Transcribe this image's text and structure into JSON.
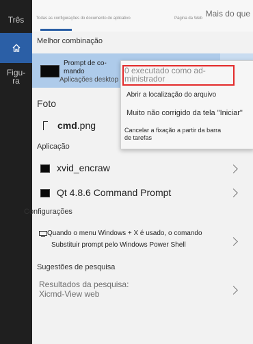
{
  "rail": {
    "top_label": "Três",
    "bottom_label": "Figu-\nra"
  },
  "tabs": {
    "all_settings": "Todas as configurações do documento do aplicativo",
    "web_page": "Página da Web",
    "more": "Mais do que"
  },
  "best_match": {
    "header": "Melhor combinação",
    "title_line1": "Prompt de co-",
    "title_line2": "mando",
    "subtitle": "Aplicações desktop"
  },
  "context_menu": {
    "run_as_admin_line1": "0 executado como ad-",
    "run_as_admin_line2": "ministrador",
    "open_location": "Abrir a localização do arquivo",
    "pin_start": "Muito não corrigido da tela \"Iniciar\"",
    "unpin_taskbar_line1": "Cancelar a fixação a partir da barra",
    "unpin_taskbar_line2": "de tarefas"
  },
  "photo": {
    "header": "Foto",
    "file_name": "cmd",
    "file_ext": ".png"
  },
  "apps": {
    "header": "Aplicação",
    "items": [
      "xvid_encraw",
      "Qt 4.8.6 Command Prompt"
    ]
  },
  "settings": {
    "header": "Configurações",
    "item_line1": "Quando o menu Windows + X é usado, o comando",
    "item_line2": "Substituir prompt pelo Windows Power Shell"
  },
  "suggestions": {
    "header": "Sugestões de pesquisa",
    "item_line1": "Resultados da pesquisa:",
    "item_line2": "Xicmd-View web"
  },
  "colors": {
    "accent": "#2b5fa6",
    "selection": "#aecbea",
    "highlight_border": "#e32a2a"
  }
}
